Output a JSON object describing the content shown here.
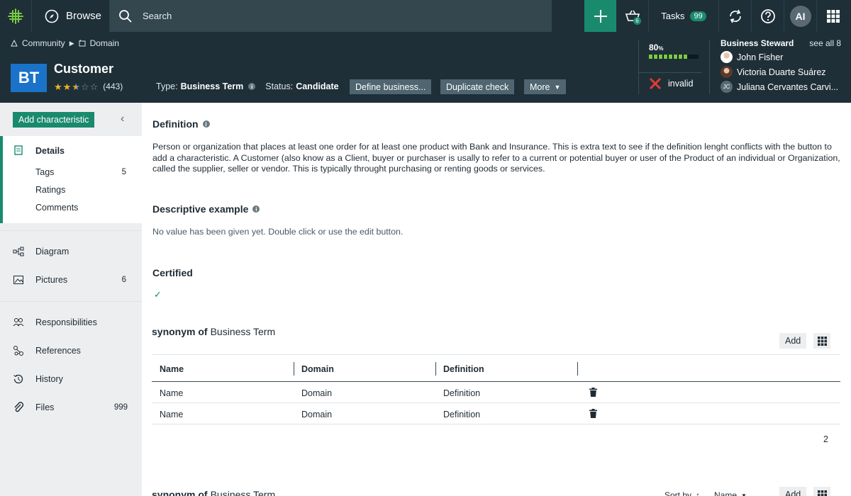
{
  "topbar": {
    "browse_label": "Browse",
    "search_placeholder": "Search",
    "basket_count": "6",
    "tasks_label": "Tasks",
    "tasks_count": "99",
    "user_initials": "AI"
  },
  "breadcrumb": {
    "community": "Community",
    "domain": "Domain"
  },
  "asset": {
    "type_abbrev": "BT",
    "name": "Customer",
    "rating_count": "(443)",
    "type_label": "Type:",
    "type_value": "Business Term",
    "status_label": "Status:",
    "status_value": "Candidate",
    "rating_stars": 2.5
  },
  "actions": {
    "define": "Define business...",
    "duplicate": "Duplicate check",
    "more": "More"
  },
  "progress": {
    "value_label": "80",
    "unit": "%",
    "fraction": 0.8
  },
  "validity": {
    "label": "invalid"
  },
  "steward": {
    "title": "Business Steward",
    "see_all": "see all 8",
    "people": [
      "John Fisher",
      "Victoria Duarte Suárez",
      "Juliana Cervantes Carvi..."
    ],
    "third_initials": "JC"
  },
  "sidebar": {
    "add_characteristic": "Add characteristic",
    "details": "Details",
    "tags": "Tags",
    "tags_count": "5",
    "ratings": "Ratings",
    "comments": "Comments",
    "diagram": "Diagram",
    "pictures": "Pictures",
    "pictures_count": "6",
    "responsibilities": "Responsibilities",
    "references": "References",
    "history": "History",
    "files": "Files",
    "files_count": "999"
  },
  "main": {
    "definition_title": "Definition",
    "definition_text": "Person or organization that places at least one order for at least one product with Bank and Insurance. This is extra text to see if the definition lenght conflicts with the button to add a characteristic. A Customer (also know as a Client, buyer or purchaser is usally to refer to a current or potential buyer or user of the Product of an individual or Organization, called the supplier, seller or vendor. This is typically throught purchasing or renting goods or services.",
    "example_title": "Descriptive example",
    "example_empty": "No value has been given yet. Double click or use the edit button.",
    "certified_title": "Certified",
    "relation_role": "synonym of",
    "relation_target": "Business Term",
    "add_label": "Add",
    "columns": [
      "Name",
      "Domain",
      "Definition"
    ],
    "rows": [
      [
        "Name",
        "Domain",
        "Definition"
      ],
      [
        "Name",
        "Domain",
        "Definition"
      ]
    ],
    "row_total": "2",
    "sort_by": "Sort by",
    "sort_field": "Name"
  },
  "colors": {
    "accent": "#1a8a6e",
    "dark": "#1e2f38",
    "brand_tile": "#1a73c9",
    "invalid": "#e53935"
  }
}
